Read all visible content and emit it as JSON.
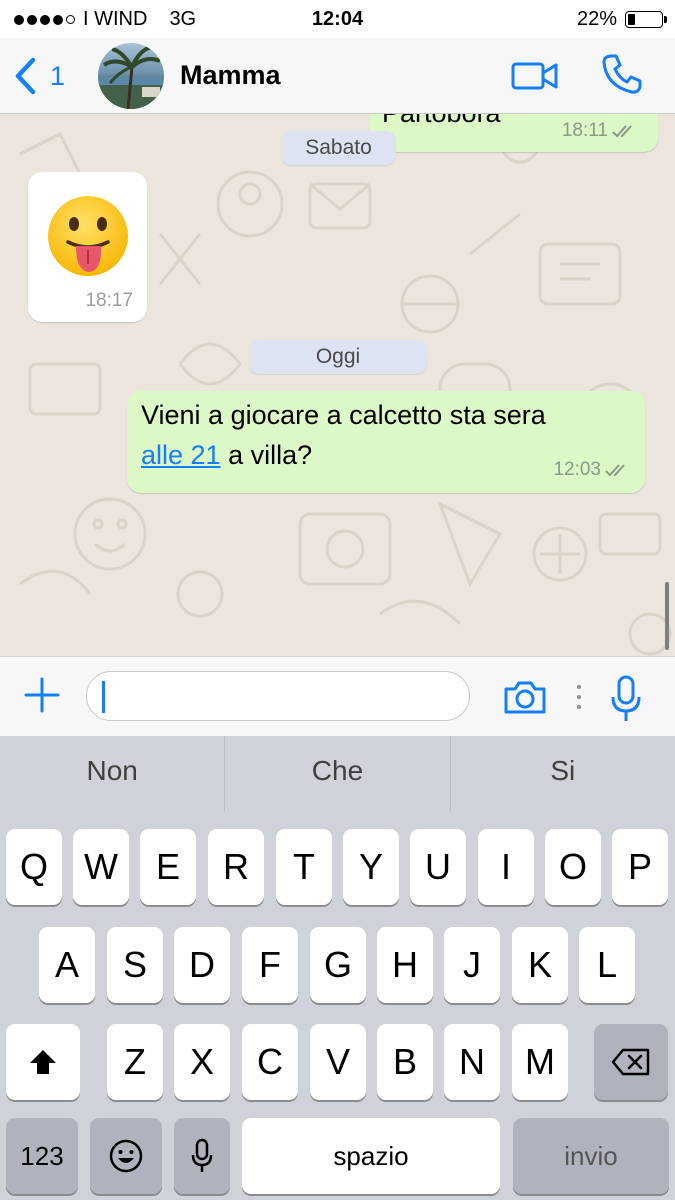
{
  "status_bar": {
    "carrier": "I WIND",
    "network": "3G",
    "time": "12:04",
    "battery_text": "22%",
    "battery_level": 0.22,
    "signal_bars": 4
  },
  "nav": {
    "back_label": "1",
    "contact_name": "Mamma",
    "accent_color": "#147efb"
  },
  "chat": {
    "partial_message": {
      "text": "Partobora",
      "time": "18:11"
    },
    "date_sabato": "Sabato",
    "emoji_message": {
      "emoji": "😛",
      "time": "18:17"
    },
    "date_oggi": "Oggi",
    "message": {
      "text_line1": "Vieni a giocare a calcetto sta sera",
      "link_text": "alle 21",
      "text_after_link": " a villa?",
      "time": "12:03"
    },
    "outgoing_bubble_color": "#dcf8c6"
  },
  "input_bar": {
    "value": "",
    "placeholder": ""
  },
  "suggestions": [
    "Non",
    "Che",
    "Si"
  ],
  "keyboard": {
    "row1": [
      "Q",
      "W",
      "E",
      "R",
      "T",
      "Y",
      "U",
      "I",
      "O",
      "P"
    ],
    "row2": [
      "A",
      "S",
      "D",
      "F",
      "G",
      "H",
      "J",
      "K",
      "L"
    ],
    "row3": [
      "Z",
      "X",
      "C",
      "V",
      "B",
      "N",
      "M"
    ],
    "numbers_key": "123",
    "space_key": "spazio",
    "return_key": "invio"
  }
}
